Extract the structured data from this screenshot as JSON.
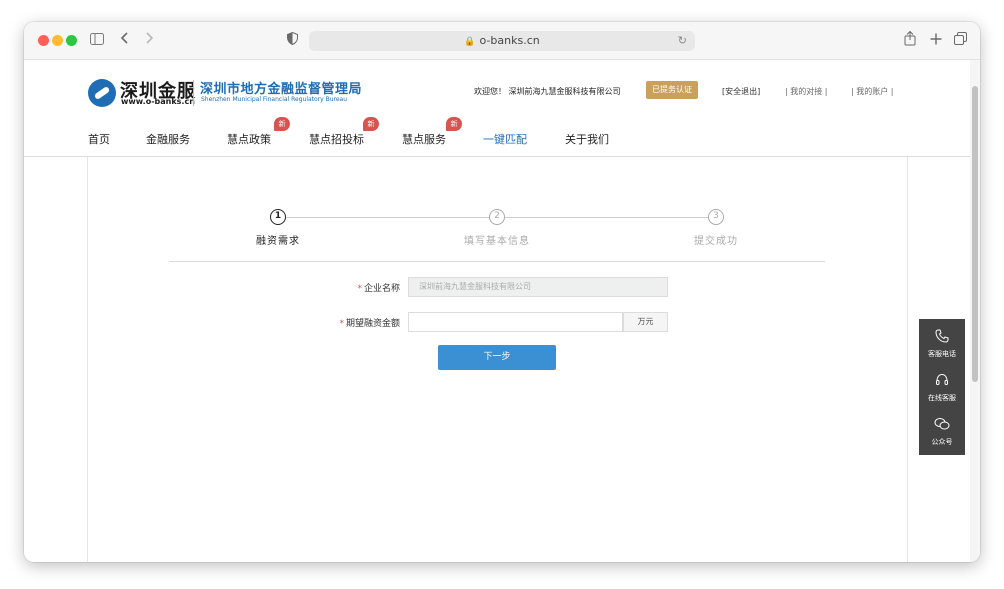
{
  "browser": {
    "url": "o-banks.cn",
    "traffic_lights": [
      "#ff5f57",
      "#febc2e",
      "#28c840"
    ],
    "toolbar_icons": [
      "sidebar-icon",
      "back-icon",
      "forward-icon",
      "shield-icon",
      "share-icon",
      "new-tab-icon",
      "tabs-icon"
    ]
  },
  "header": {
    "logo_cn": "深圳金服",
    "logo_url": "www.o-banks.cn",
    "bureau_name": "深圳市地方金融监督管理局",
    "bureau_en": "Shenzhen Municipal Financial Regulatory Bureau",
    "welcome": "欢迎您！ 深圳前海九慧金服科技有限公司",
    "verified": "已提务认证",
    "logout": "[安全退出]",
    "my_match": "我的对接",
    "my_account": "我的账户"
  },
  "nav": {
    "home": "首页",
    "finance": "金融服务",
    "policy": "慧点政策",
    "bidding": "慧点招投标",
    "service": "慧点服务",
    "match": "一键匹配",
    "about": "关于我们",
    "new_badge": "新"
  },
  "steps": [
    {
      "num": "1",
      "label": "融资需求"
    },
    {
      "num": "2",
      "label": "填写基本信息"
    },
    {
      "num": "3",
      "label": "提交成功"
    }
  ],
  "form": {
    "required_mark": "*",
    "company_label": "企业名称",
    "company_value": "深圳前海九慧金服科技有限公司",
    "amount_label": "期望融资金额",
    "amount_value": "",
    "amount_unit": "万元",
    "next_button": "下一步"
  },
  "float_panel": {
    "phone_label": "客服电话",
    "online_label": "在线客服",
    "wechat_label": "公众号"
  },
  "colors": {
    "brand_blue": "#1f6db5",
    "gold": "#c9a15b",
    "badge_red": "#d9544f",
    "button_blue": "#3b8fd3"
  }
}
